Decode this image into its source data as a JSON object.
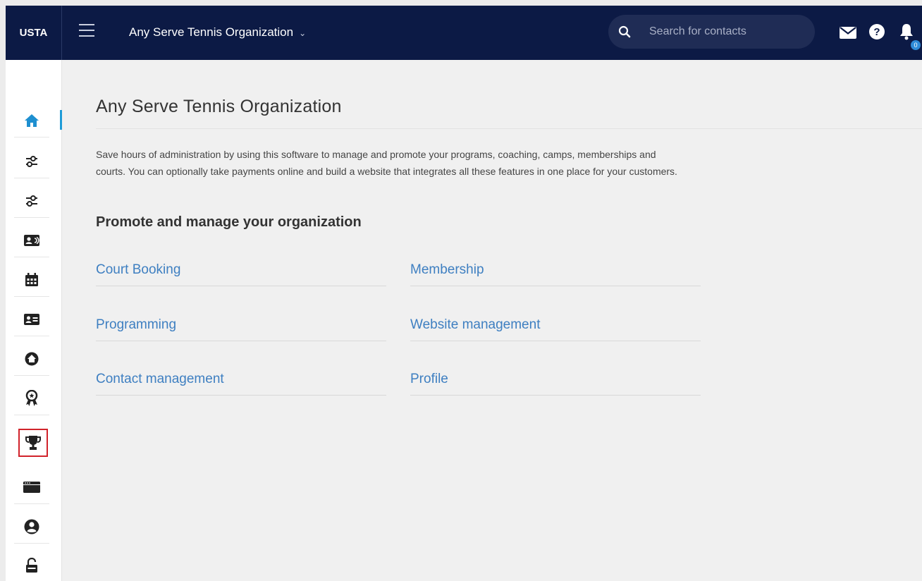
{
  "header": {
    "logo": "USTA",
    "org_name": "Any Serve Tennis Organization",
    "search_placeholder": "Search for contacts",
    "notification_count": "0"
  },
  "sidebar": {
    "items": [
      {
        "icon": "home-icon",
        "active": true
      },
      {
        "icon": "sliders-icon"
      },
      {
        "icon": "sliders-icon"
      },
      {
        "icon": "contact-card-icon"
      },
      {
        "icon": "calendar-icon"
      },
      {
        "icon": "id-card-icon"
      },
      {
        "icon": "circle-home-icon"
      },
      {
        "icon": "award-icon"
      },
      {
        "icon": "trophy-icon",
        "highlighted": true
      },
      {
        "icon": "browser-window-icon"
      },
      {
        "icon": "user-circle-icon"
      },
      {
        "icon": "unlock-icon"
      }
    ]
  },
  "main": {
    "title": "Any Serve Tennis Organization",
    "intro": "Save hours of administration by using this software to manage and promote your programs, coaching, camps, memberships and courts. You can optionally take payments online and build a website that integrates all these features in one place for your customers.",
    "section_title": "Promote and manage your organization",
    "links": [
      {
        "label": "Court Booking"
      },
      {
        "label": "Membership"
      },
      {
        "label": "Programming"
      },
      {
        "label": "Website management"
      },
      {
        "label": "Contact management"
      },
      {
        "label": "Profile"
      }
    ]
  },
  "colors": {
    "topbar": "#0c1a45",
    "link": "#3e7fc1",
    "active_indicator": "#1e9bd7",
    "highlight": "#d1232b"
  }
}
